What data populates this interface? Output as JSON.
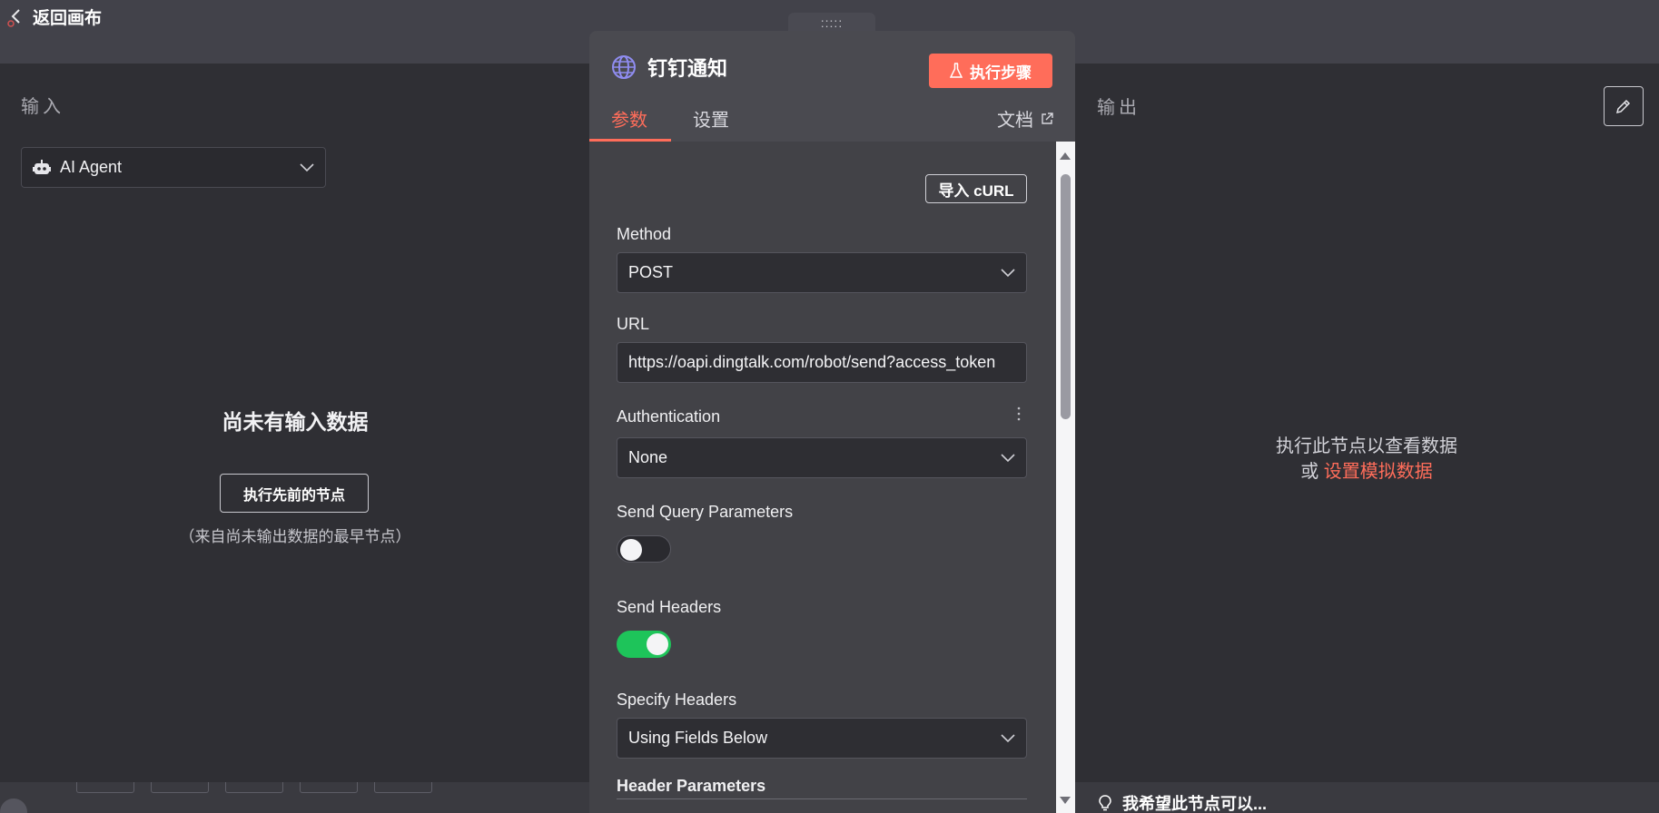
{
  "canvas": {
    "back_label": "返回画布",
    "bottom_hint": "我希望此节点可以..."
  },
  "input_panel": {
    "label": "输入",
    "source_node": "AI Agent",
    "empty_title": "尚未有输入数据",
    "run_previous_label": "执行先前的节点",
    "run_previous_note": "（来自尚未输出数据的最早节点）"
  },
  "output_panel": {
    "label": "输出",
    "message_line1": "执行此节点以查看数据",
    "message_or": "或",
    "mock_data_link": "设置模拟数据"
  },
  "node": {
    "drag_handle": ":::::",
    "title": "钉钉通知",
    "execute_label": "执行步骤",
    "tabs": [
      {
        "label": "参数"
      },
      {
        "label": "设置"
      }
    ],
    "docs_label": "文档",
    "import_curl_label": "导入 cURL",
    "method": {
      "label": "Method",
      "value": "POST"
    },
    "url": {
      "label": "URL",
      "value": "https://oapi.dingtalk.com/robot/send?access_token"
    },
    "authentication": {
      "label": "Authentication",
      "value": "None"
    },
    "send_query": {
      "label": "Send Query Parameters",
      "enabled": false
    },
    "send_headers": {
      "label": "Send Headers",
      "enabled": true
    },
    "specify_headers": {
      "label": "Specify Headers",
      "value": "Using Fields Below"
    },
    "header_parameters": {
      "label": "Header Parameters"
    }
  },
  "colors": {
    "accent": "#ff6d5a",
    "toggle_on": "#1ec45a",
    "panel_bg": "#2f2f34",
    "node_bg": "#424247"
  }
}
